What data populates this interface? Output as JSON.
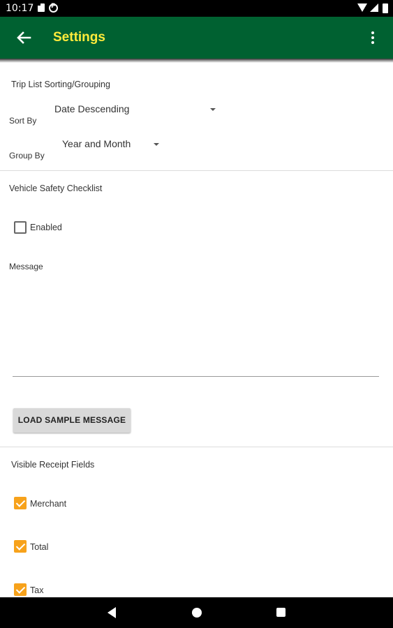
{
  "status_bar": {
    "time": "10:17",
    "icons": [
      "sd-card-icon",
      "p-icon",
      "wifi-icon",
      "cell-signal-icon",
      "battery-icon"
    ]
  },
  "app_bar": {
    "title": "Settings",
    "back_icon": "arrow-back-icon",
    "menu_icon": "more-vert-icon",
    "background": "#006131",
    "title_color": "#ffeb3b"
  },
  "trip_list": {
    "section_title": "Trip List Sorting/Grouping",
    "sort_by": {
      "label": "Sort By",
      "value": "Date Descending"
    },
    "group_by": {
      "label": "Group By",
      "value": "Year and Month"
    }
  },
  "safety_checklist": {
    "section_title": "Vehicle Safety Checklist",
    "enabled": {
      "label": "Enabled",
      "checked": false
    },
    "message": {
      "label": "Message",
      "value": ""
    },
    "load_sample_button": "LOAD SAMPLE MESSAGE"
  },
  "receipt_fields": {
    "section_title": "Visible Receipt Fields",
    "items": [
      {
        "label": "Merchant",
        "checked": true
      },
      {
        "label": "Total",
        "checked": true
      },
      {
        "label": "Tax",
        "checked": true
      }
    ],
    "checkbox_color": "#f7a21b"
  },
  "nav_bar": {
    "icons": [
      "nav-back-icon",
      "nav-home-icon",
      "nav-recents-icon"
    ]
  }
}
